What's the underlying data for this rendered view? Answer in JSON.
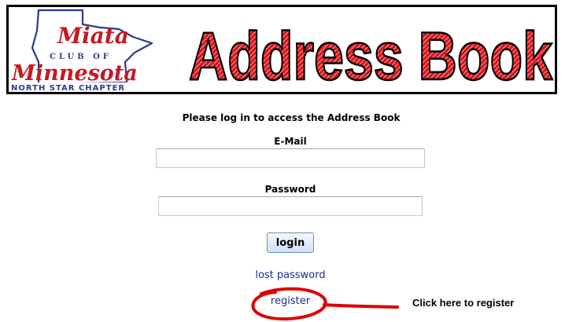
{
  "header": {
    "logo": {
      "script_line1": "Miata",
      "club_line": "CLUB OF",
      "script_line2": "Minnesota",
      "chapter_line": "NORTH STAR CHAPTER"
    },
    "title": "Address Book"
  },
  "login": {
    "intro": "Please log in to access the Address Book",
    "email_label": "E-Mail",
    "email_value": "",
    "password_label": "Password",
    "password_value": "",
    "login_button": "login",
    "lost_password_link": "lost password",
    "register_link": "register"
  },
  "annotation": {
    "text": "Click here to register",
    "color": "#e00000"
  },
  "colors": {
    "title_red": "#d4161c",
    "logo_blue": "#2b3a8f",
    "logo_red": "#c41a23",
    "link_blue": "#1f2d8f"
  }
}
